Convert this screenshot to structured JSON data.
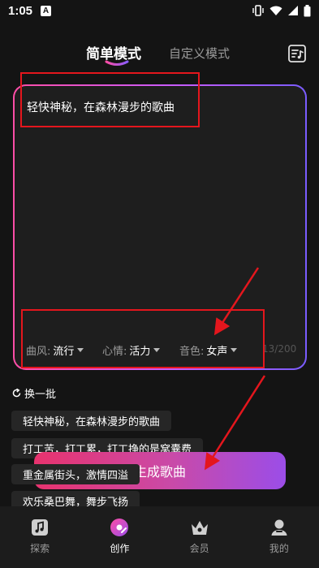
{
  "status_bar": {
    "time": "1:05",
    "notification_letter": "A"
  },
  "header": {
    "tabs": [
      {
        "label": "简单模式",
        "active": true
      },
      {
        "label": "自定义模式",
        "active": false
      }
    ],
    "right_icon": "music-list-icon"
  },
  "input": {
    "text": "轻快神秘，在森林漫步的歌曲",
    "char_count": "13/200",
    "options": [
      {
        "label": "曲风:",
        "value": "流行"
      },
      {
        "label": "心情:",
        "value": "活力"
      },
      {
        "label": "音色:",
        "value": "女声"
      }
    ]
  },
  "suggestions": {
    "refresh_label": "换一批",
    "chips": [
      "轻快神秘，在森林漫步的歌曲",
      "打工苦，打工累，打工挣的是窝囊费",
      "重金属街头，激情四溢",
      "欢乐桑巴舞，舞步飞扬"
    ]
  },
  "generate_button": {
    "label": "生成歌曲"
  },
  "bottom_nav": [
    {
      "label": "探索",
      "icon": "music-note-icon",
      "active": false
    },
    {
      "label": "创作",
      "icon": "disc-create-icon",
      "active": true
    },
    {
      "label": "会员",
      "icon": "crown-icon",
      "active": false
    },
    {
      "label": "我的",
      "icon": "profile-icon",
      "active": false
    }
  ],
  "colors": {
    "background": "#141414",
    "accent_pink": "#e8336e",
    "accent_purple": "#9b4de8",
    "annotation_red": "#e4161d"
  }
}
